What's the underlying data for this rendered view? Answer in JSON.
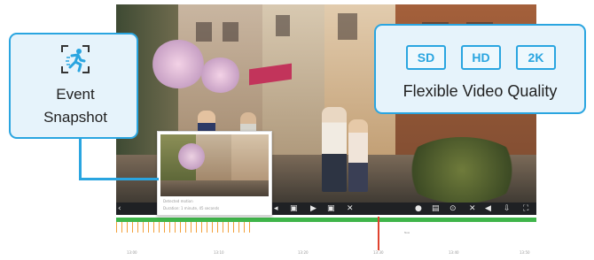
{
  "event_callout": {
    "label_line1": "Event",
    "label_line2": "Snapshot",
    "icon": "motion-detect-running-person-icon"
  },
  "quality_callout": {
    "badges": [
      "SD",
      "HD",
      "2K"
    ],
    "label": "Flexible Video Quality"
  },
  "snapshot_popup": {
    "caption_line1": "Detected motion",
    "caption_line2": "Duration: 1 minute, 45 seconds"
  },
  "timeline": {
    "marker_label": "Now",
    "times": [
      "13:00",
      "13:10",
      "13:20",
      "13:30",
      "13:40",
      "13:50"
    ]
  },
  "colors": {
    "accent": "#2aa5e0",
    "callout_bg": "#e6f3fb",
    "timeline_bar": "#3fb54a",
    "timeline_marker": "#e0432f",
    "event_ticks": "#f3a03a"
  }
}
